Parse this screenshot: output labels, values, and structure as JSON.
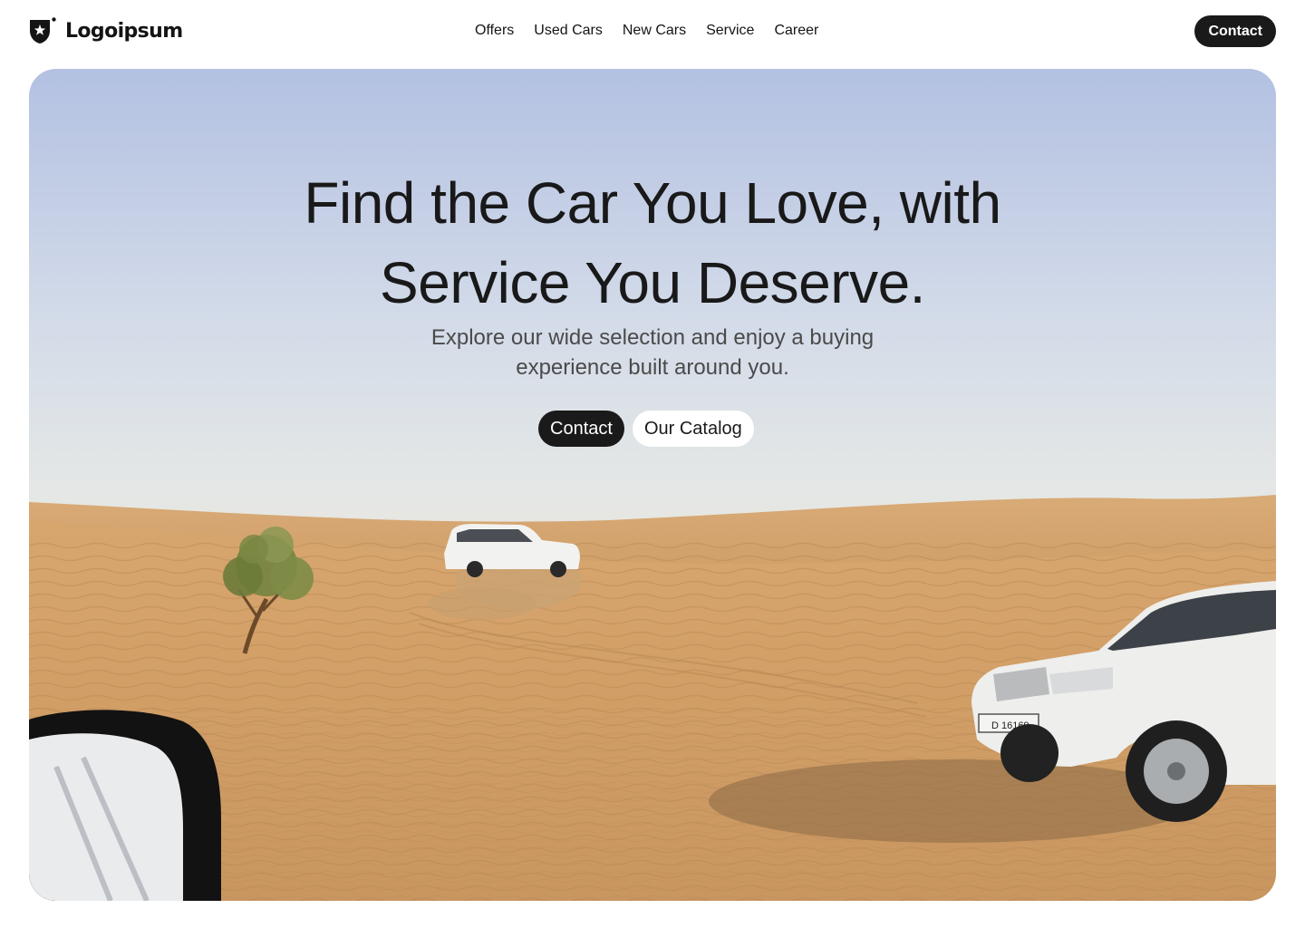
{
  "brand": {
    "name": "Logoipsum",
    "logo_icon": "shield-star-icon"
  },
  "nav": {
    "items": [
      {
        "label": "Offers"
      },
      {
        "label": "Used Cars"
      },
      {
        "label": "New Cars"
      },
      {
        "label": "Service"
      },
      {
        "label": "Career"
      }
    ]
  },
  "header": {
    "contact_label": "Contact"
  },
  "hero": {
    "title_line1": "Find the Car You Love, with",
    "title_line2": "Service You Deserve.",
    "subtitle": "Explore our wide selection and enjoy a buying experience built around you.",
    "primary_button": "Contact",
    "secondary_button": "Our Catalog",
    "image_description_icon": "desert-suv-photo"
  },
  "colors": {
    "primary": "#1a1a1a",
    "background": "#ffffff",
    "sky": "#b3c1e2",
    "sand": "#d9a56d"
  }
}
